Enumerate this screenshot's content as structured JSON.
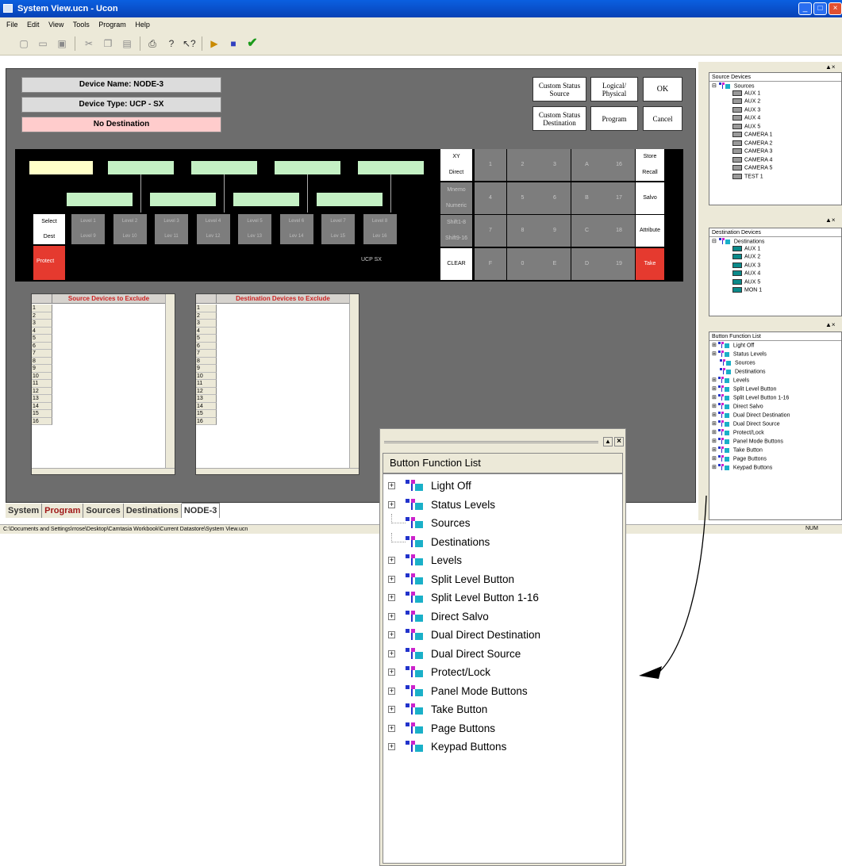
{
  "window": {
    "title": "System View.ucn - Ucon"
  },
  "menu": [
    "File",
    "Edit",
    "View",
    "Tools",
    "Program",
    "Help"
  ],
  "device": {
    "name": "Device Name: NODE-3",
    "type": "Device Type: UCP - SX",
    "dest": "No Destination"
  },
  "buttons": {
    "custom_status_source": "Custom Status Source",
    "logical_physical": "Logical/ Physical",
    "ok": "OK",
    "custom_status_dest": "Custom Status Destination",
    "program": "Program",
    "cancel": "Cancel"
  },
  "panel": {
    "select": "Select",
    "dest": "Dest",
    "protect": "Protect",
    "model": "UCP SX",
    "levels_top": [
      "Level 1",
      "Level 2",
      "Level 3",
      "Level 4",
      "Level 5",
      "Level 6",
      "Level 7",
      "Level 8"
    ],
    "levels_bottom": [
      "Level 9",
      "Lev 10",
      "Lev 11",
      "Lev 12",
      "Lev 13",
      "Lev 14",
      "Lev 15",
      "Lev 16"
    ],
    "keypad": {
      "left_col": [
        [
          "XY",
          "Direct"
        ],
        [
          "Mnemo",
          "Numeric"
        ],
        [
          "Shift1-8",
          "Shift9-16"
        ],
        [
          "CLEAR",
          ""
        ]
      ],
      "row1": [
        "1",
        "2",
        "3",
        "A",
        "16"
      ],
      "row2": [
        "4",
        "5",
        "6",
        "B",
        "17"
      ],
      "row3": [
        "7",
        "8",
        "9",
        "C",
        "18"
      ],
      "row4": [
        "F",
        "0",
        "E",
        "D",
        "19"
      ],
      "right_col": [
        [
          "Store",
          "Recall"
        ],
        [
          "Salvo",
          ""
        ],
        [
          "Attribute",
          ""
        ],
        [
          "Take",
          ""
        ]
      ]
    }
  },
  "grids": {
    "source_title": "Source Devices to Exclude",
    "dest_title": "Destination Devices to Exclude",
    "rows": [
      "1",
      "2",
      "3",
      "4",
      "5",
      "6",
      "7",
      "8",
      "9",
      "10",
      "11",
      "12",
      "13",
      "14",
      "15",
      "16"
    ]
  },
  "tabs": [
    "System",
    "Program",
    "Sources",
    "Destinations",
    "NODE-3"
  ],
  "status": {
    "path": "C:\\Documents and Settings\\rrose\\Desktop\\Camtasia Workbook\\Current Datastore\\System View.ucn",
    "num": "NUM"
  },
  "source_devices": {
    "title": "Source Devices",
    "root": "Sources",
    "items": [
      "AUX 1",
      "AUX 2",
      "AUX 3",
      "AUX 4",
      "AUX 5",
      "CAMERA 1",
      "CAMERA 2",
      "CAMERA 3",
      "CAMERA 4",
      "CAMERA 5",
      "TEST 1"
    ]
  },
  "destination_devices": {
    "title": "Destination Devices",
    "root": "Destinations",
    "items": [
      "AUX 1",
      "AUX 2",
      "AUX 3",
      "AUX 4",
      "AUX 5",
      "MON 1"
    ]
  },
  "button_function_list": {
    "title": "Button Function List",
    "items": [
      {
        "label": "Light Off",
        "expand": true
      },
      {
        "label": "Status Levels",
        "expand": true
      },
      {
        "label": "Sources",
        "expand": false
      },
      {
        "label": "Destinations",
        "expand": false
      },
      {
        "label": "Levels",
        "expand": true
      },
      {
        "label": "Split Level Button",
        "expand": true
      },
      {
        "label": "Split Level Button 1-16",
        "expand": true
      },
      {
        "label": "Direct Salvo",
        "expand": true
      },
      {
        "label": "Dual Direct Destination",
        "expand": true
      },
      {
        "label": "Dual Direct Source",
        "expand": true
      },
      {
        "label": "Protect/Lock",
        "expand": true
      },
      {
        "label": "Panel Mode Buttons",
        "expand": true
      },
      {
        "label": "Take Button",
        "expand": true
      },
      {
        "label": "Page Buttons",
        "expand": true
      },
      {
        "label": "Keypad Buttons",
        "expand": true
      }
    ]
  }
}
